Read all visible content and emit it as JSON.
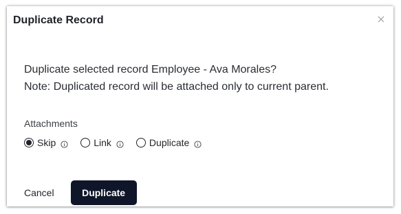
{
  "dialog": {
    "title": "Duplicate Record",
    "close_icon": "close-icon",
    "message_line1": "Duplicate selected record Employee - Ava Morales?",
    "message_line2": "Note: Duplicated record will be attached only to current parent.",
    "attachments_label": "Attachments",
    "options": [
      {
        "label": "Skip",
        "selected": true,
        "icon": "info-icon"
      },
      {
        "label": "Link",
        "selected": false,
        "icon": "info-icon"
      },
      {
        "label": "Duplicate",
        "selected": false,
        "icon": "info-icon"
      }
    ],
    "cancel_label": "Cancel",
    "primary_label": "Duplicate",
    "primary_color": "#0f1629"
  }
}
